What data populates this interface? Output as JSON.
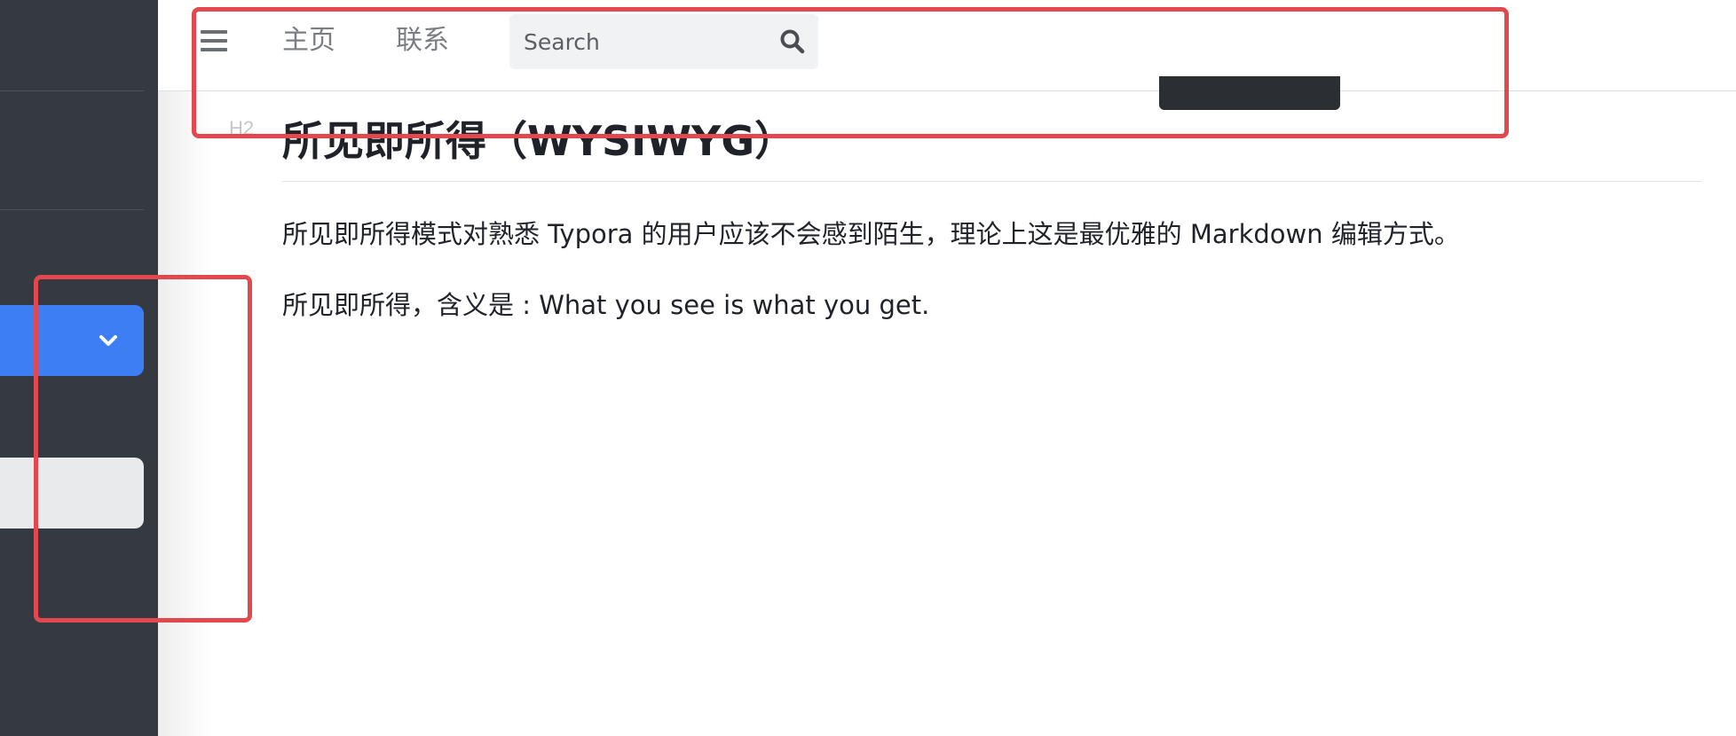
{
  "nav": {
    "home_label": "主页",
    "contact_label": "联系",
    "search_placeholder": "Search"
  },
  "content": {
    "heading_tag": "H2",
    "title": "所见即所得（WYSIWYG）",
    "paragraphs": [
      "所见即所得模式对熟悉 Typora 的用户应该不会感到陌生，理论上这是最优雅的 Markdown 编辑方式。",
      "所见即所得，含义是 : What you see is what you get."
    ]
  },
  "icons": {
    "menu": "hamburger-menu-icon",
    "search": "search-icon",
    "dropdown": "chevron-down-icon"
  },
  "colors": {
    "sidebar_bg": "#343a40",
    "accent_blue": "#3d7ef5",
    "annotation_red": "#e2484d",
    "nav_text": "#7a7e82"
  }
}
